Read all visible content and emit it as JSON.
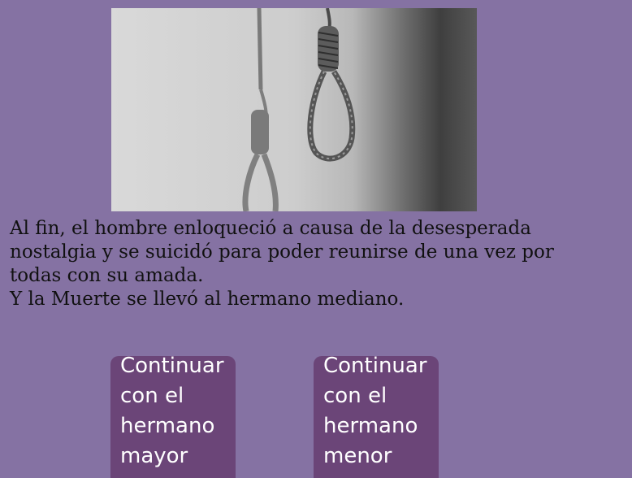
{
  "image": {
    "subject": "hanging-noose-icon"
  },
  "story": {
    "paragraph1": "Al fin, el hombre enloqueció a causa de la desesperada nostalgia y se suicidó para poder reunirse de una vez por todas con su amada.",
    "paragraph2": "Y la Muerte se llevó al hermano mediano."
  },
  "choices": [
    {
      "label": "Continuar con el hermano mayor"
    },
    {
      "label": "Continuar con el hermano menor"
    }
  ],
  "colors": {
    "background": "#8572a3",
    "button": "#6b4578",
    "button_text": "#ffffff"
  }
}
